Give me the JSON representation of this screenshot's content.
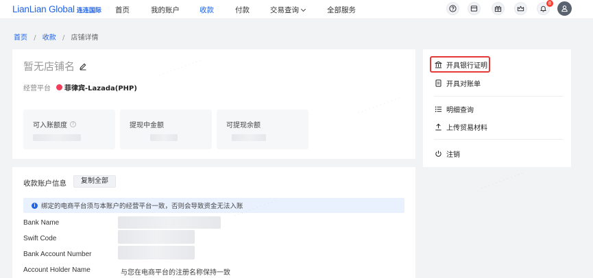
{
  "brand": {
    "name_en": "LianLian Global",
    "name_cn": "连连国际",
    "color": "#1f63e6"
  },
  "nav": {
    "items": [
      "首页",
      "我的账户",
      "收款",
      "付款",
      "交易查询",
      "全部服务"
    ],
    "active": "收款"
  },
  "header": {
    "notification_count": "8"
  },
  "breadcrumb": {
    "home": "首页",
    "parent": "收款",
    "current": "店铺详情",
    "separator": "/"
  },
  "store": {
    "name": "暂无店铺名",
    "platform_label": "经营平台",
    "platform_value": "菲律宾-Lazada(PHP)",
    "stats": [
      {
        "label": "可入账额度",
        "has_info": true
      },
      {
        "label": "提现中金额",
        "has_info": false
      },
      {
        "label": "可提现余额",
        "has_info": false
      }
    ]
  },
  "account": {
    "title": "收款账户信息",
    "copy_all": "复制全部",
    "notice": "绑定的电商平台须与本账户的经营平台一致，否则会导致资金无法入账",
    "fields": [
      {
        "label": "Bank Name",
        "value": ""
      },
      {
        "label": "Swift Code",
        "value": ""
      },
      {
        "label": "Bank Account Number",
        "value": ""
      },
      {
        "label": "Account Holder Name",
        "value": "与您在电商平台的注册名称保持一致"
      }
    ]
  },
  "side_menu": {
    "group1": [
      "开具银行证明",
      "开具对账单"
    ],
    "group2": [
      "明细查询",
      "上传贸易材料"
    ],
    "group3": [
      "注销"
    ],
    "highlight_color": "#e53935"
  }
}
